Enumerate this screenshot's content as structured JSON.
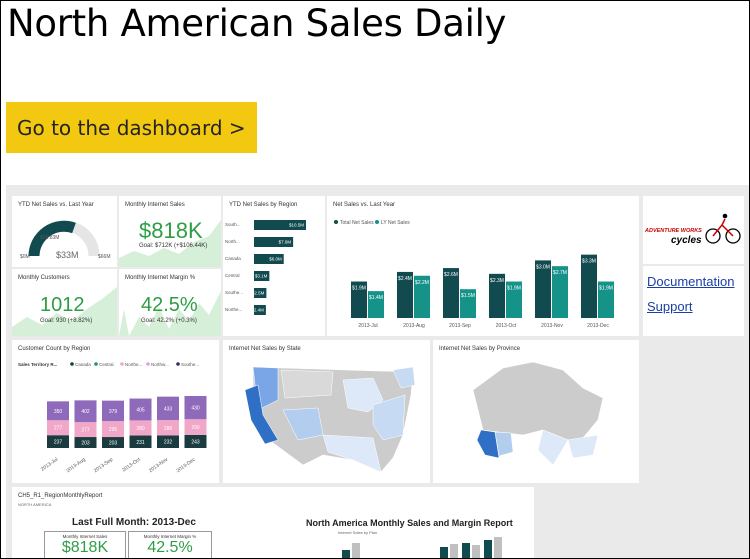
{
  "page_title": "North American Sales Daily",
  "goto_button": "Go to the dashboard >",
  "tiles": {
    "ytd_vs_last_year": {
      "title": "YTD Net Sales vs. Last Year",
      "left_label": "$26.83M",
      "min": "$0M",
      "center": "$33M",
      "max": "$66M"
    },
    "monthly_internet_sales": {
      "title": "Monthly Internet Sales",
      "value": "$818K",
      "goal": "Goal: $712K (+$106.44K)"
    },
    "ytd_by_region": {
      "title": "YTD Net Sales by Region"
    },
    "net_sales_vs_last_year": {
      "title": "Net Sales vs. Last Year",
      "legend": [
        "Total Net Sales",
        "LY Net Sales"
      ]
    },
    "monthly_customers": {
      "title": "Monthly Customers",
      "value": "1012",
      "goal": "Goal: 930 (+8.82%)"
    },
    "monthly_margin": {
      "title": "Monthly Internet Margin %",
      "value": "42.5%",
      "goal": "Goal: 42.2% (+0.3%)"
    },
    "customer_count": {
      "title": "Customer Count by Region",
      "legend_title": "Sales Territory R...",
      "legend": [
        "Canada",
        "Central",
        "Northe...",
        "Northw...",
        "Southe..."
      ]
    },
    "internet_by_state": {
      "title": "Internet Net Sales by State"
    },
    "internet_by_province": {
      "title": "Internet Net Sales by Province"
    },
    "report": {
      "title": "CH5_R1_RegionMonthlyReport",
      "subtitle": "NORTH AMERICA",
      "last_month": "Last Full Month: 2013-Dec",
      "card1_label": "Monthly Internet Sales",
      "card1_value": "$818K",
      "card2_label": "Monthly Internet Margin %",
      "card2_value": "42.5%",
      "heading": "North America Monthly Sales and Margin Report",
      "sub": "Internet Sales by Plan"
    },
    "links": {
      "documentation": "Documentation",
      "support": "Support",
      "logo_top": "ADVENTURE WORKS",
      "logo_bottom": "cycles"
    }
  },
  "chart_data": [
    {
      "type": "bar",
      "title": "YTD Net Sales by Region",
      "categories": [
        "South...",
        "North...",
        "Canada",
        "Central",
        "Southe...",
        "Northe..."
      ],
      "values": [
        10.5,
        7.9,
        6.0,
        3.1,
        2.5,
        2.4
      ],
      "labels": [
        "$10.5M",
        "$7.9M",
        "$6.0M",
        "$3.1M",
        "$2.5M",
        "$2.4M"
      ]
    },
    {
      "type": "bar",
      "title": "Net Sales vs. Last Year",
      "categories": [
        "2013-Jul",
        "2013-Aug",
        "2013-Sep",
        "2013-Oct",
        "2013-Nov",
        "2013-Dec"
      ],
      "series": [
        {
          "name": "Total Net Sales",
          "values": [
            1.9,
            2.4,
            2.6,
            2.3,
            3.0,
            3.3
          ],
          "labels": [
            "$1.9M",
            "$2.4M",
            "$2.6M",
            "$2.3M",
            "$3.0M",
            "$3.3M"
          ]
        },
        {
          "name": "LY Net Sales",
          "values": [
            1.4,
            2.2,
            1.5,
            1.9,
            2.7,
            1.9
          ],
          "labels": [
            "$1.4M",
            "$2.2M",
            "$1.5M",
            "$1.9M",
            "$2.7M",
            "$1.9M"
          ]
        }
      ],
      "colors": [
        "#114a4f",
        "#169389"
      ]
    },
    {
      "type": "bar",
      "title": "Customer Count by Region",
      "categories": [
        "2013-Jul",
        "2013-Aug",
        "2013-Sep",
        "2013-Oct",
        "2013-Nov",
        "2013-Dec"
      ],
      "series": [
        {
          "name": "Canada",
          "values": [
            237,
            203,
            203,
            231,
            232,
            243
          ]
        },
        {
          "name": "Northe...",
          "values": [
            277,
            277,
            295,
            280,
            286,
            290
          ]
        },
        {
          "name": "Northw...",
          "values": [
            350,
            402,
            379,
            405,
            433,
            430
          ]
        }
      ],
      "colors": [
        "#1a3b3f",
        "#f0a7c8",
        "#8f6aba"
      ]
    }
  ]
}
